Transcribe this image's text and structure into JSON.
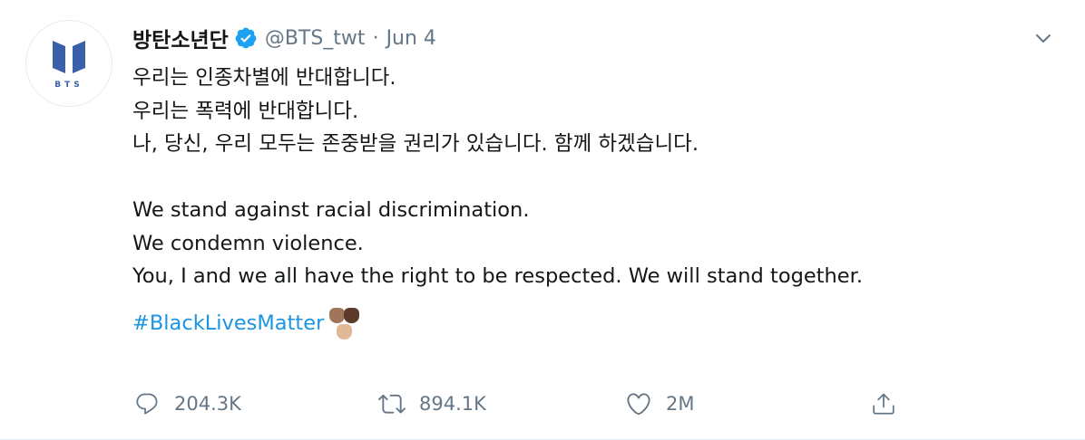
{
  "tweet": {
    "display_name": "방탄소년단",
    "handle": "@BTS_twt",
    "separator": "·",
    "time": "Jun 4",
    "avatar_text": "BTS",
    "lines": {
      "ko1": "우리는 인종차별에 반대합니다.",
      "ko2": "우리는 폭력에 반대합니다.",
      "ko3": "나, 당신, 우리 모두는 존중받을 권리가 있습니다. 함께 하겠습니다.",
      "en1": "We stand against racial discrimination.",
      "en2": "We condemn violence.",
      "en3": "You, I and we all have the right to be respected. We will stand together."
    },
    "hashtag": "#BlackLivesMatter"
  },
  "actions": {
    "reply_count": "204.3K",
    "retweet_count": "894.1K",
    "like_count": "2M"
  },
  "colors": {
    "link": "#1b95e0",
    "muted": "#657786",
    "verified": "#1da1f2",
    "logo": "#3b5fa8"
  },
  "icons": [
    "verified-badge-icon",
    "chevron-down-icon",
    "reply-icon",
    "retweet-icon",
    "like-icon",
    "share-icon",
    "raised-fist-emoji"
  ]
}
